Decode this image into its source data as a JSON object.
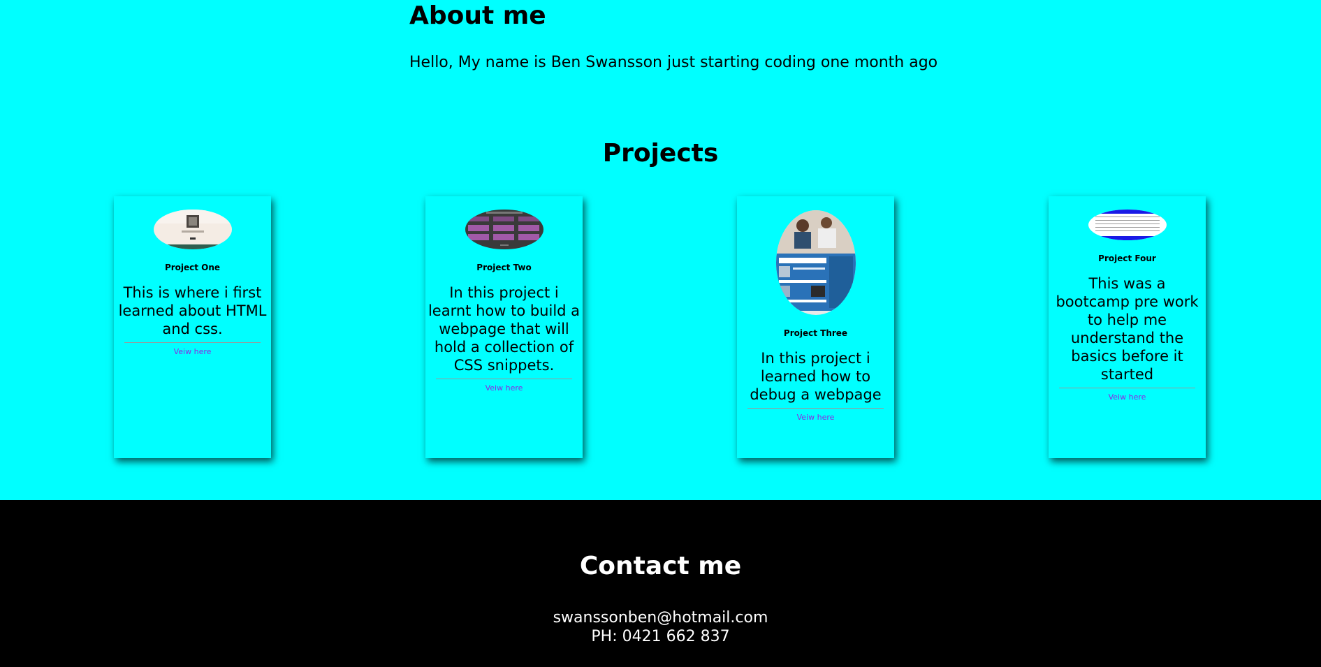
{
  "about": {
    "title": "About me",
    "text": "Hello, My name is Ben Swansson just starting coding one month ago"
  },
  "projects": {
    "title": "Projects",
    "items": [
      {
        "title": "Project One",
        "desc": "This is where i first learned about HTML and css.",
        "link": "Veiw here"
      },
      {
        "title": "Project Two",
        "desc": "In this project i learnt how to build a webpage that will hold a collection of CSS snippets.",
        "link": "Veiw here"
      },
      {
        "title": "Project Three",
        "desc": "In this project i learned how to debug a webpage",
        "link": "Veiw here"
      },
      {
        "title": "Project Four",
        "desc": "This was a bootcamp pre work to help me understand the basics before it started",
        "link": "Veiw here"
      }
    ]
  },
  "contact": {
    "title": "Contact me",
    "email": "swanssonben@hotmail.com",
    "phone": "PH: 0421 662 837"
  }
}
